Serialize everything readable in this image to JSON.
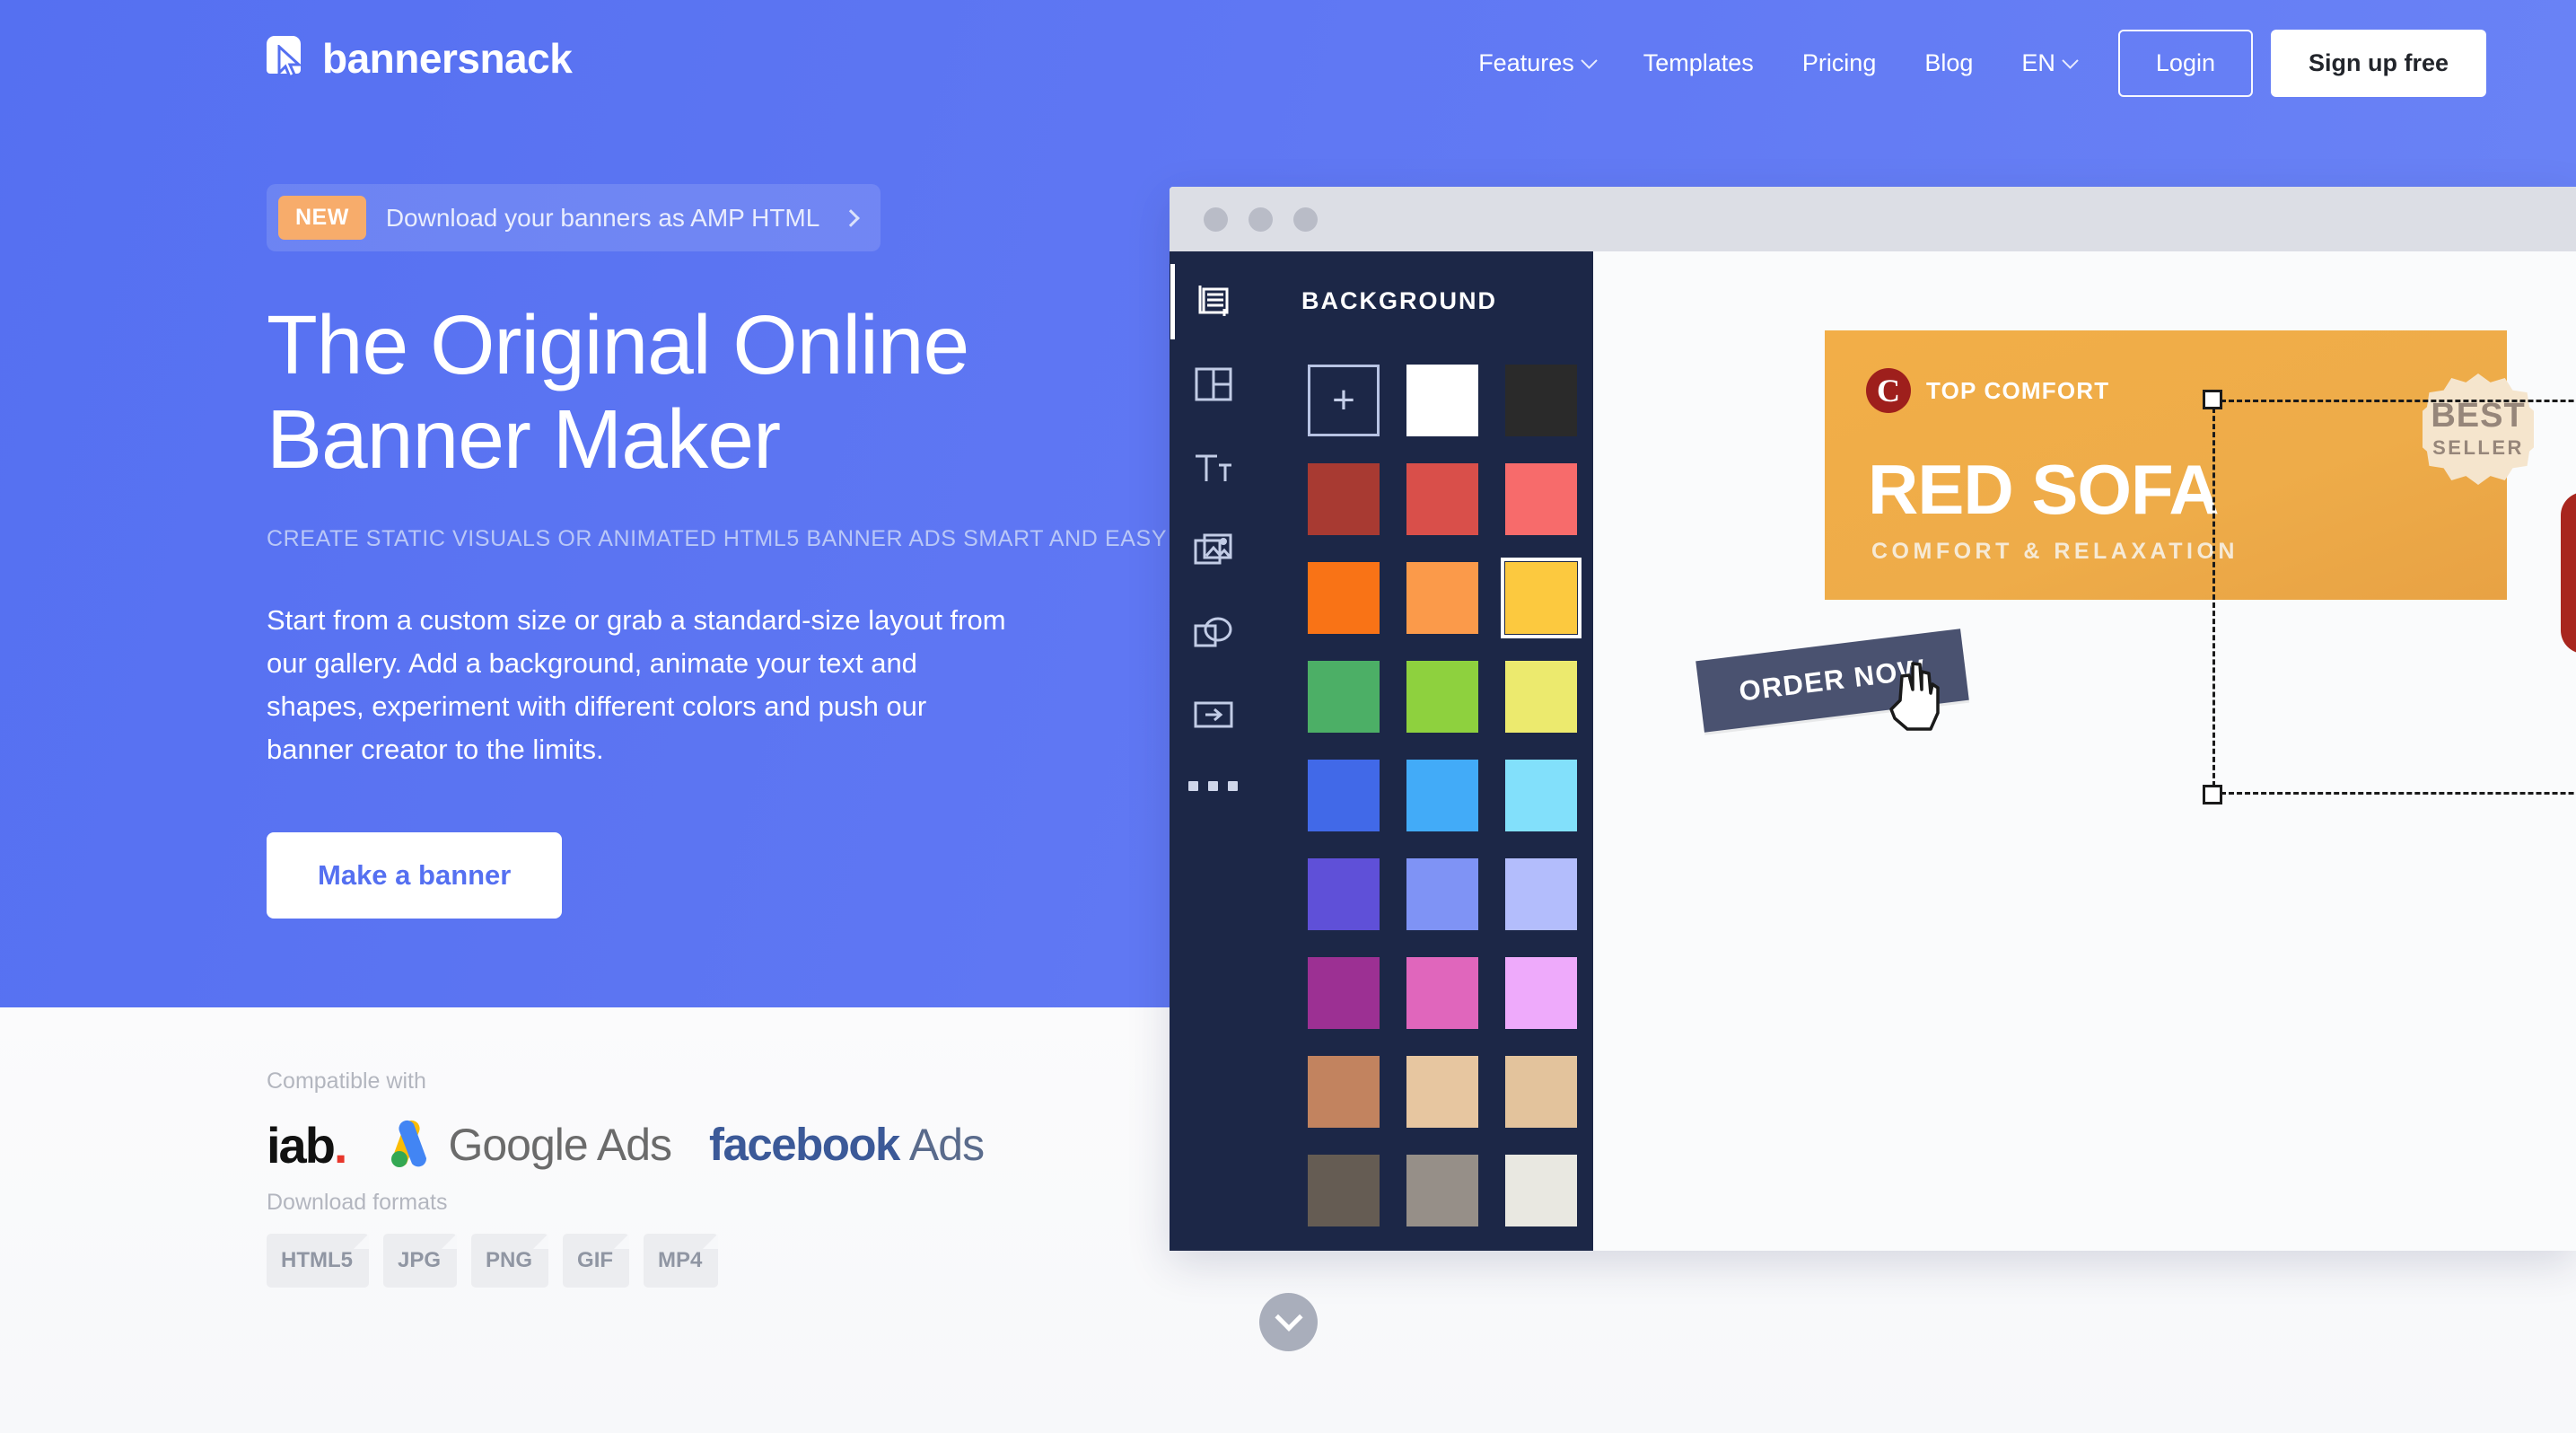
{
  "brand": {
    "name": "bannersnack",
    "logo_icon": "cursor-card-icon"
  },
  "nav": {
    "items": [
      {
        "label": "Features",
        "has_chevron": true
      },
      {
        "label": "Templates",
        "has_chevron": false
      },
      {
        "label": "Pricing",
        "has_chevron": false
      },
      {
        "label": "Blog",
        "has_chevron": false
      },
      {
        "label": "EN",
        "has_chevron": true
      }
    ],
    "login_label": "Login",
    "signup_label": "Sign up free"
  },
  "hero": {
    "announcement": {
      "badge": "NEW",
      "text": "Download your banners as AMP HTML",
      "arrow_icon": "chevron-right-icon"
    },
    "title_line1": "The Original Online",
    "title_line2": "Banner Maker",
    "subtitle": "CREATE STATIC VISUALS OR ANIMATED HTML5 BANNER ADS SMART AND EASY",
    "paragraph": "Start from a custom size or grab a standard-size layout from our gallery. Add a background, animate your text and shapes, experiment with different colors and push our banner creator to the limits.",
    "cta_label": "Make a banner",
    "background_color": "#5570F1",
    "cta_text_color": "#5570F1",
    "badge_color": "#F7AC6B"
  },
  "compatible": {
    "label": "Compatible with",
    "logos": [
      {
        "name": "iab",
        "text": "iab",
        "colors": [
          "#111111",
          "#e8362b"
        ]
      },
      {
        "name": "google-ads",
        "text": "Google Ads",
        "colors": [
          "#4285F4",
          "#FBBC04",
          "#34A853"
        ]
      },
      {
        "name": "facebook-ads",
        "text_bold": "facebook",
        "text_light": "Ads",
        "colors": [
          "#3b5998"
        ]
      }
    ]
  },
  "download_formats": {
    "label": "Download formats",
    "chips": [
      "HTML5",
      "JPG",
      "PNG",
      "GIF",
      "MP4"
    ]
  },
  "editor": {
    "window_dots": 3,
    "rail_icons": [
      {
        "name": "background-icon",
        "active": true
      },
      {
        "name": "layout-grid-icon",
        "active": false
      },
      {
        "name": "text-icon",
        "active": false
      },
      {
        "name": "images-icon",
        "active": false
      },
      {
        "name": "shapes-icon",
        "active": false
      },
      {
        "name": "animation-arrow-icon",
        "active": false
      },
      {
        "name": "more-dots-icon",
        "active": false
      }
    ],
    "panel_title": "BACKGROUND",
    "add_swatch_label": "+",
    "swatches": [
      {
        "color": "#ffffff",
        "selected": false
      },
      {
        "color": "#2a2a2a",
        "selected": false
      },
      {
        "color": "#a83a32",
        "selected": false
      },
      {
        "color": "#d94f4a",
        "selected": false
      },
      {
        "color": "#f76b6b",
        "selected": false
      },
      {
        "color": "#f97316",
        "selected": false
      },
      {
        "color": "#fb9a4a",
        "selected": false
      },
      {
        "color": "#fcc93f",
        "selected": true
      },
      {
        "color": "#4caf66",
        "selected": false
      },
      {
        "color": "#8ed13e",
        "selected": false
      },
      {
        "color": "#ecea6e",
        "selected": false
      },
      {
        "color": "#4169e8",
        "selected": false
      },
      {
        "color": "#42abf8",
        "selected": false
      },
      {
        "color": "#82e0fb",
        "selected": false
      },
      {
        "color": "#5f50d8",
        "selected": false
      },
      {
        "color": "#7f93f5",
        "selected": false
      },
      {
        "color": "#b3bdfc",
        "selected": false
      },
      {
        "color": "#9c3093",
        "selected": false
      },
      {
        "color": "#e066bc",
        "selected": false
      },
      {
        "color": "#eeaafb",
        "selected": false
      },
      {
        "color": "#c2835f",
        "selected": false
      },
      {
        "color": "#e7c6a0",
        "selected": false
      },
      {
        "color": "#e3c39c",
        "selected": false
      },
      {
        "color": "#655c53",
        "selected": false
      },
      {
        "color": "#968f88",
        "selected": false
      },
      {
        "color": "#e9e8e1",
        "selected": false
      }
    ],
    "canvas_banner": {
      "brand_mark": "C",
      "brand_name": "TOP COMFORT",
      "headline": "RED SOFA",
      "subline": "COMFORT & RELAXATION",
      "badge_line1": "BEST",
      "badge_line2": "SELLER",
      "cta_label": "ORDER NOW",
      "background_color": "#f0ac48",
      "cta_color": "#4a5270",
      "sofa_color": "#b42b22"
    }
  },
  "scroll_down": {
    "icon": "chevron-down-icon"
  }
}
